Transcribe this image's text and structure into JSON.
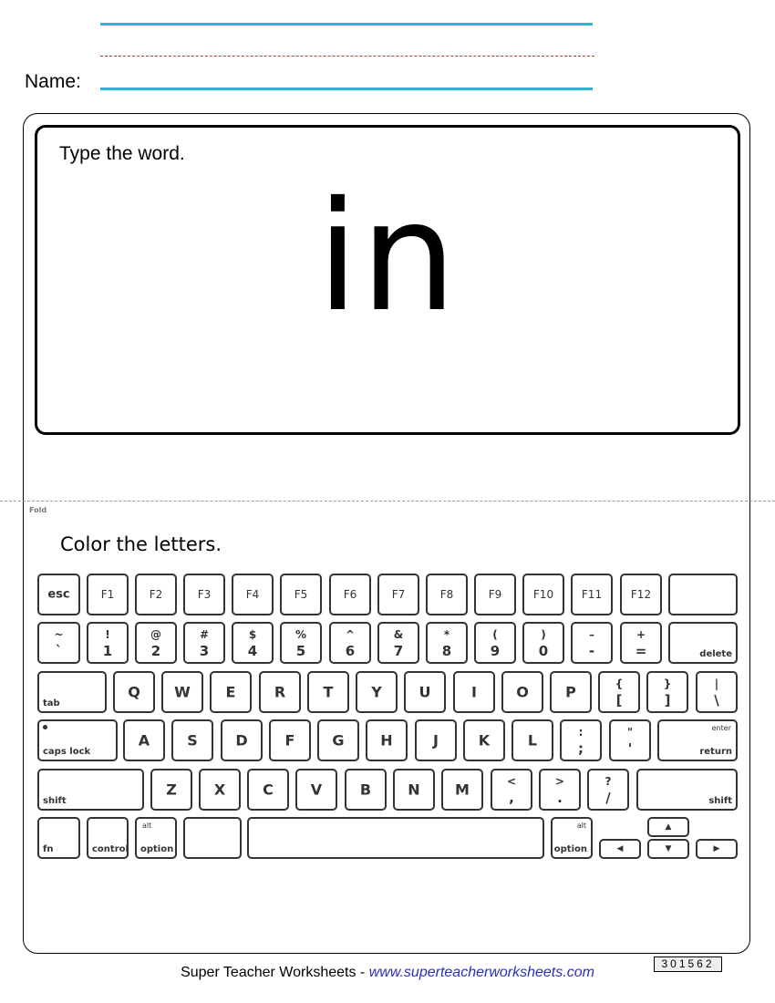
{
  "header": {
    "name_label": "Name:"
  },
  "word_panel": {
    "instruction": "Type the word.",
    "word": "in"
  },
  "fold": {
    "label": "Fold"
  },
  "keyboard_panel": {
    "instruction": "Color the letters."
  },
  "keyboard": {
    "rows": [
      [
        {
          "id": "esc",
          "type": "esc",
          "center": "esc"
        },
        {
          "id": "f1",
          "type": "fn",
          "center": "F1"
        },
        {
          "id": "f2",
          "type": "fn",
          "center": "F2"
        },
        {
          "id": "f3",
          "type": "fn",
          "center": "F3"
        },
        {
          "id": "f4",
          "type": "fn",
          "center": "F4"
        },
        {
          "id": "f5",
          "type": "fn",
          "center": "F5"
        },
        {
          "id": "f6",
          "type": "fn",
          "center": "F6"
        },
        {
          "id": "f7",
          "type": "fn",
          "center": "F7"
        },
        {
          "id": "f8",
          "type": "fn",
          "center": "F8"
        },
        {
          "id": "f9",
          "type": "fn",
          "center": "F9"
        },
        {
          "id": "f10",
          "type": "fn",
          "center": "F10"
        },
        {
          "id": "f11",
          "type": "fn",
          "center": "F11"
        },
        {
          "id": "f12",
          "type": "fn",
          "center": "F12"
        },
        {
          "id": "power",
          "type": "blank"
        }
      ],
      [
        {
          "id": "backtick",
          "type": "dual",
          "top": "~",
          "bottom": "`"
        },
        {
          "id": "1",
          "type": "dual",
          "top": "!",
          "bottom": "1"
        },
        {
          "id": "2",
          "type": "dual",
          "top": "@",
          "bottom": "2"
        },
        {
          "id": "3",
          "type": "dual",
          "top": "#",
          "bottom": "3"
        },
        {
          "id": "4",
          "type": "dual",
          "top": "$",
          "bottom": "4"
        },
        {
          "id": "5",
          "type": "dual",
          "top": "%",
          "bottom": "5"
        },
        {
          "id": "6",
          "type": "dual",
          "top": "^",
          "bottom": "6"
        },
        {
          "id": "7",
          "type": "dual",
          "top": "&",
          "bottom": "7"
        },
        {
          "id": "8",
          "type": "dual",
          "top": "*",
          "bottom": "8"
        },
        {
          "id": "9",
          "type": "dual",
          "top": "(",
          "bottom": "9"
        },
        {
          "id": "0",
          "type": "dual",
          "top": ")",
          "bottom": "0"
        },
        {
          "id": "minus",
          "type": "dual",
          "top": "–",
          "bottom": "-"
        },
        {
          "id": "equals",
          "type": "dual",
          "top": "+",
          "bottom": "="
        },
        {
          "id": "delete",
          "type": "mod",
          "br": "delete"
        }
      ],
      [
        {
          "id": "tab",
          "type": "mod",
          "bl": "tab"
        },
        {
          "id": "q",
          "type": "letter",
          "center": "Q"
        },
        {
          "id": "w",
          "type": "letter",
          "center": "W"
        },
        {
          "id": "e",
          "type": "letter",
          "center": "E"
        },
        {
          "id": "r",
          "type": "letter",
          "center": "R"
        },
        {
          "id": "t",
          "type": "letter",
          "center": "T"
        },
        {
          "id": "y",
          "type": "letter",
          "center": "Y"
        },
        {
          "id": "u",
          "type": "letter",
          "center": "U"
        },
        {
          "id": "i",
          "type": "letter",
          "center": "I"
        },
        {
          "id": "o",
          "type": "letter",
          "center": "O"
        },
        {
          "id": "p",
          "type": "letter",
          "center": "P"
        },
        {
          "id": "lbracket",
          "type": "dual",
          "top": "{",
          "bottom": "["
        },
        {
          "id": "rbracket",
          "type": "dual",
          "top": "}",
          "bottom": "]"
        },
        {
          "id": "backslash",
          "type": "dual",
          "top": "|",
          "bottom": "\\"
        }
      ],
      [
        {
          "id": "caps-lock",
          "type": "mod",
          "bl": "caps lock",
          "dot": true
        },
        {
          "id": "a",
          "type": "letter",
          "center": "A"
        },
        {
          "id": "s",
          "type": "letter",
          "center": "S"
        },
        {
          "id": "d",
          "type": "letter",
          "center": "D"
        },
        {
          "id": "f",
          "type": "letter",
          "center": "F"
        },
        {
          "id": "g",
          "type": "letter",
          "center": "G"
        },
        {
          "id": "h",
          "type": "letter",
          "center": "H"
        },
        {
          "id": "j",
          "type": "letter",
          "center": "J"
        },
        {
          "id": "k",
          "type": "letter",
          "center": "K"
        },
        {
          "id": "l",
          "type": "letter",
          "center": "L"
        },
        {
          "id": "semicolon",
          "type": "dual",
          "top": ":",
          "bottom": ";"
        },
        {
          "id": "quote",
          "type": "dual",
          "top": "\"",
          "bottom": "'"
        },
        {
          "id": "return",
          "type": "mod",
          "br": "return",
          "tr": "enter"
        }
      ],
      [
        {
          "id": "shift-left",
          "type": "mod",
          "bl": "shift"
        },
        {
          "id": "z",
          "type": "letter",
          "center": "Z"
        },
        {
          "id": "x",
          "type": "letter",
          "center": "X"
        },
        {
          "id": "c",
          "type": "letter",
          "center": "C"
        },
        {
          "id": "v",
          "type": "letter",
          "center": "V"
        },
        {
          "id": "b",
          "type": "letter",
          "center": "B"
        },
        {
          "id": "n",
          "type": "letter",
          "center": "N"
        },
        {
          "id": "m",
          "type": "letter",
          "center": "M"
        },
        {
          "id": "comma",
          "type": "dual",
          "top": "<",
          "bottom": ","
        },
        {
          "id": "period",
          "type": "dual",
          "top": ">",
          "bottom": "."
        },
        {
          "id": "slash",
          "type": "dual",
          "top": "?",
          "bottom": "/"
        },
        {
          "id": "shift-right",
          "type": "mod",
          "br": "shift"
        }
      ],
      [
        {
          "id": "fn",
          "type": "mod",
          "bl": "fn"
        },
        {
          "id": "control",
          "type": "mod",
          "bl": "control"
        },
        {
          "id": "option-left",
          "type": "mod",
          "bl": "option",
          "tl": "alt"
        },
        {
          "id": "command",
          "type": "blank"
        },
        {
          "id": "space",
          "type": "blank"
        },
        {
          "id": "option-right",
          "type": "mod",
          "br": "option",
          "tr": "alt"
        },
        {
          "id": "arrow-left",
          "type": "arrow",
          "center": "◀"
        },
        {
          "id": "arrow-up",
          "type": "arrow",
          "center": "▲"
        },
        {
          "id": "arrow-down",
          "type": "arrow",
          "center": "▼"
        },
        {
          "id": "arrow-right",
          "type": "arrow",
          "center": "▶"
        }
      ]
    ]
  },
  "footer": {
    "brand": "Super Teacher Worksheets - ",
    "url": "www.superteacherworksheets.com",
    "code": "301562"
  },
  "colors": {
    "writing_line": "#2fb3cc",
    "midline": "#c0392b",
    "link": "#2b2fbf"
  }
}
